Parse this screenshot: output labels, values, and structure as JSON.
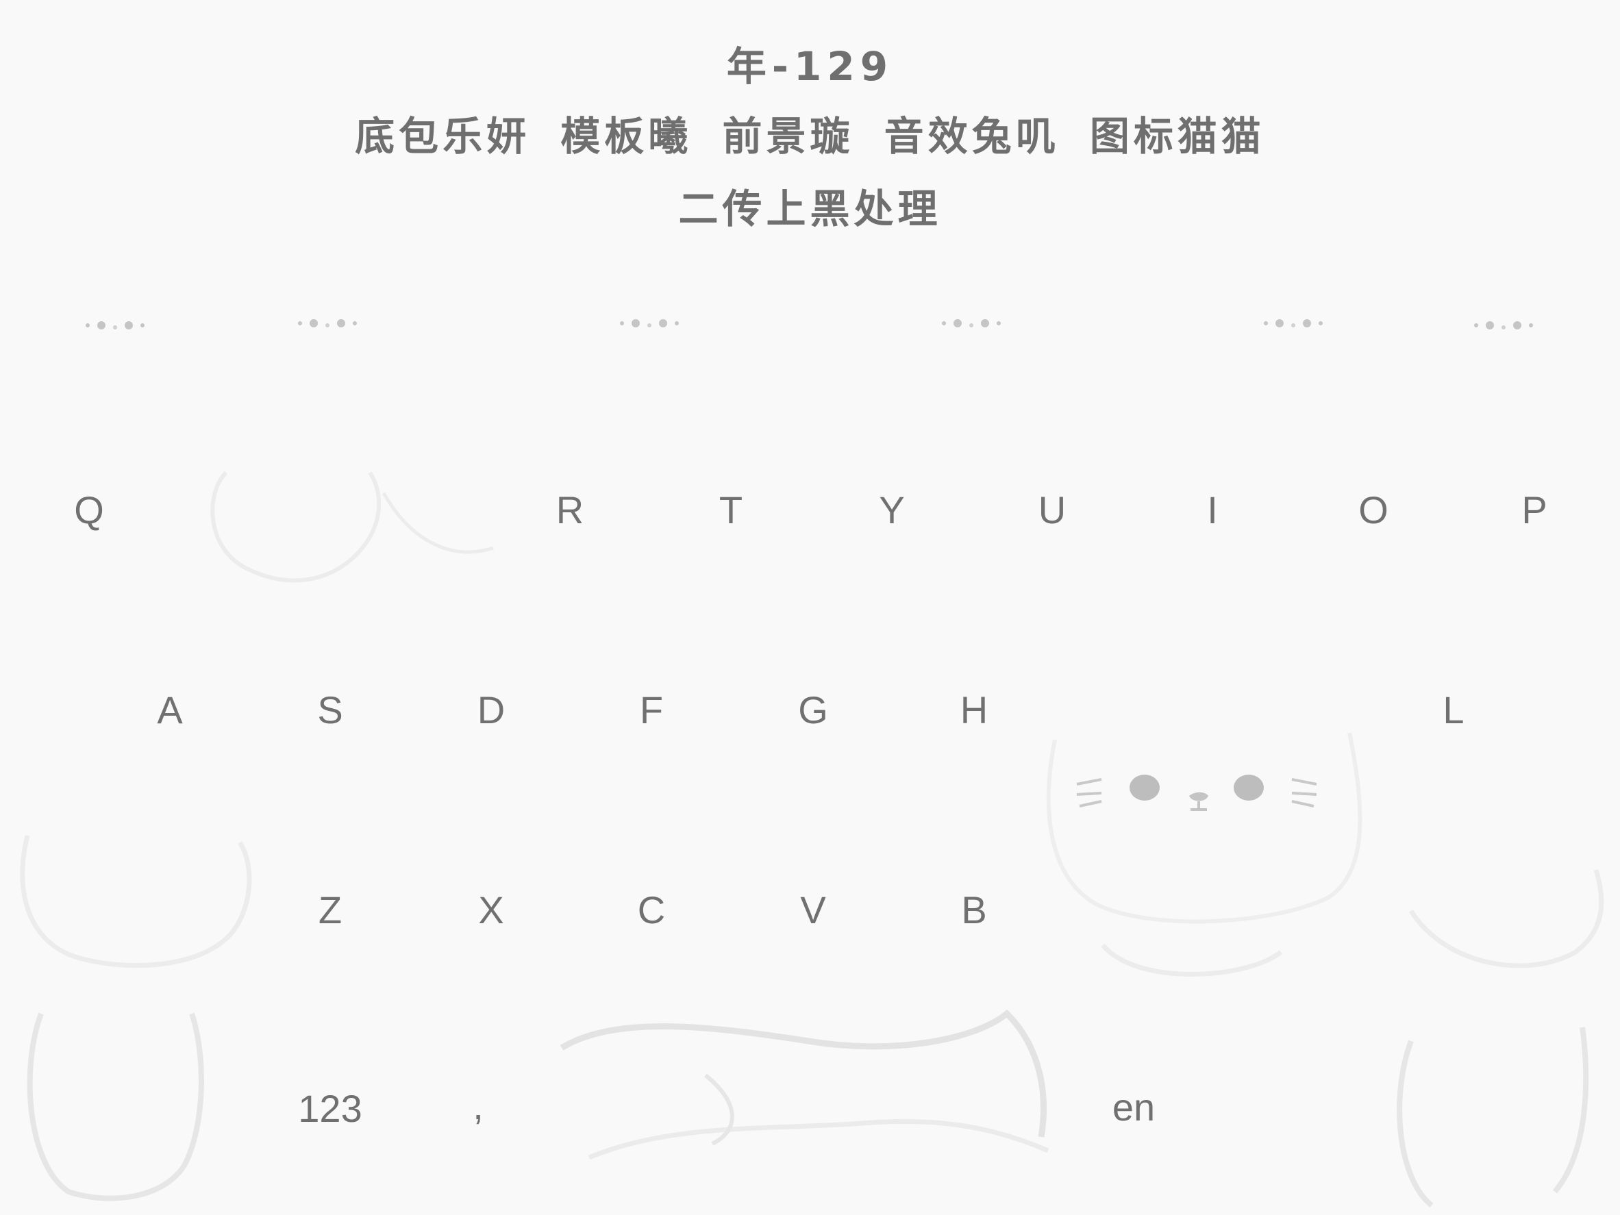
{
  "header": {
    "title": "年-129",
    "credits": "底包乐妍 模板曦 前景璇 音效兔叽 图标猫猫",
    "note": "二传上黑处理"
  },
  "keyboard": {
    "row1": [
      "Q",
      "",
      "",
      "R",
      "T",
      "Y",
      "U",
      "I",
      "O",
      "P"
    ],
    "row2": [
      "A",
      "S",
      "D",
      "F",
      "G",
      "H",
      "",
      "",
      "L"
    ],
    "row3": [
      "",
      "Z",
      "X",
      "C",
      "V",
      "B",
      "",
      "",
      ""
    ],
    "row4": {
      "numbers_label": "123",
      "comma_label": ",",
      "language_label": "en"
    }
  },
  "colors": {
    "background": "#f9f9f9",
    "text": "#6f6f6f",
    "cat_face": "#bdbdbd",
    "outline": "#e8e8e8"
  }
}
